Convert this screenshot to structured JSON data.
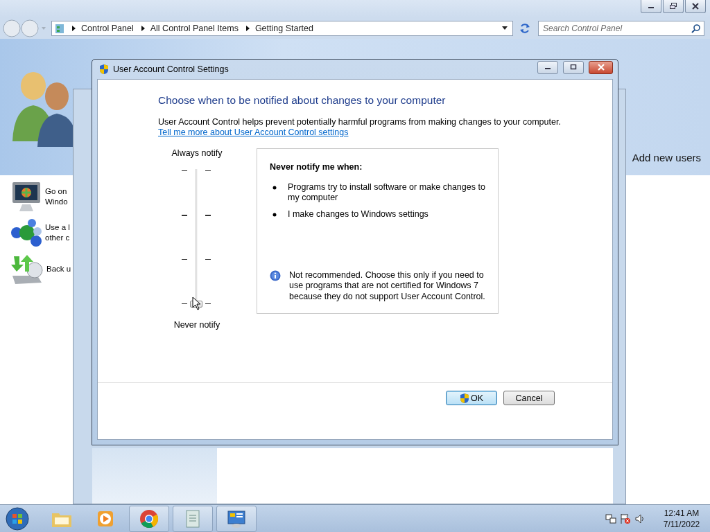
{
  "explorer": {
    "breadcrumb": [
      "Control Panel",
      "All Control Panel Items",
      "Getting Started"
    ],
    "search": {
      "placeholder": "Search Control Panel"
    },
    "header_link": "Add new users",
    "items": [
      {
        "kind": "monitor",
        "lines": [
          "Go on",
          "Windo"
        ]
      },
      {
        "kind": "globes",
        "lines": [
          "Use a l",
          "other c"
        ]
      },
      {
        "kind": "backup",
        "lines": [
          "Back u"
        ]
      }
    ]
  },
  "dialog": {
    "title": "User Account Control Settings",
    "heading": "Choose when to be notified about changes to your computer",
    "description": "User Account Control helps prevent potentially harmful programs from making changes to your computer.",
    "link": "Tell me more about User Account Control settings",
    "slider": {
      "top_label": "Always notify",
      "bottom_label": "Never notify",
      "level": 0
    },
    "panel": {
      "title": "Never notify me when:",
      "bullets": [
        "Programs try to install software or make changes to my computer",
        "I make changes to Windows settings"
      ],
      "note": "Not recommended. Choose this only if you need to use programs that are not certified for Windows 7 because they do not support User Account Control."
    },
    "buttons": [
      {
        "label": "OK",
        "kind": "shield",
        "default": true
      },
      {
        "label": "Cancel",
        "kind": "plain",
        "default": false
      }
    ]
  },
  "taskbar": {
    "apps": [
      {
        "kind": "folder",
        "open": false
      },
      {
        "kind": "media",
        "open": false
      },
      {
        "kind": "browser",
        "open": true
      },
      {
        "kind": "document",
        "open": true
      },
      {
        "kind": "control-panel",
        "open": true
      }
    ],
    "clock": {
      "time": "12:41 AM",
      "date": "7/11/2022"
    }
  }
}
